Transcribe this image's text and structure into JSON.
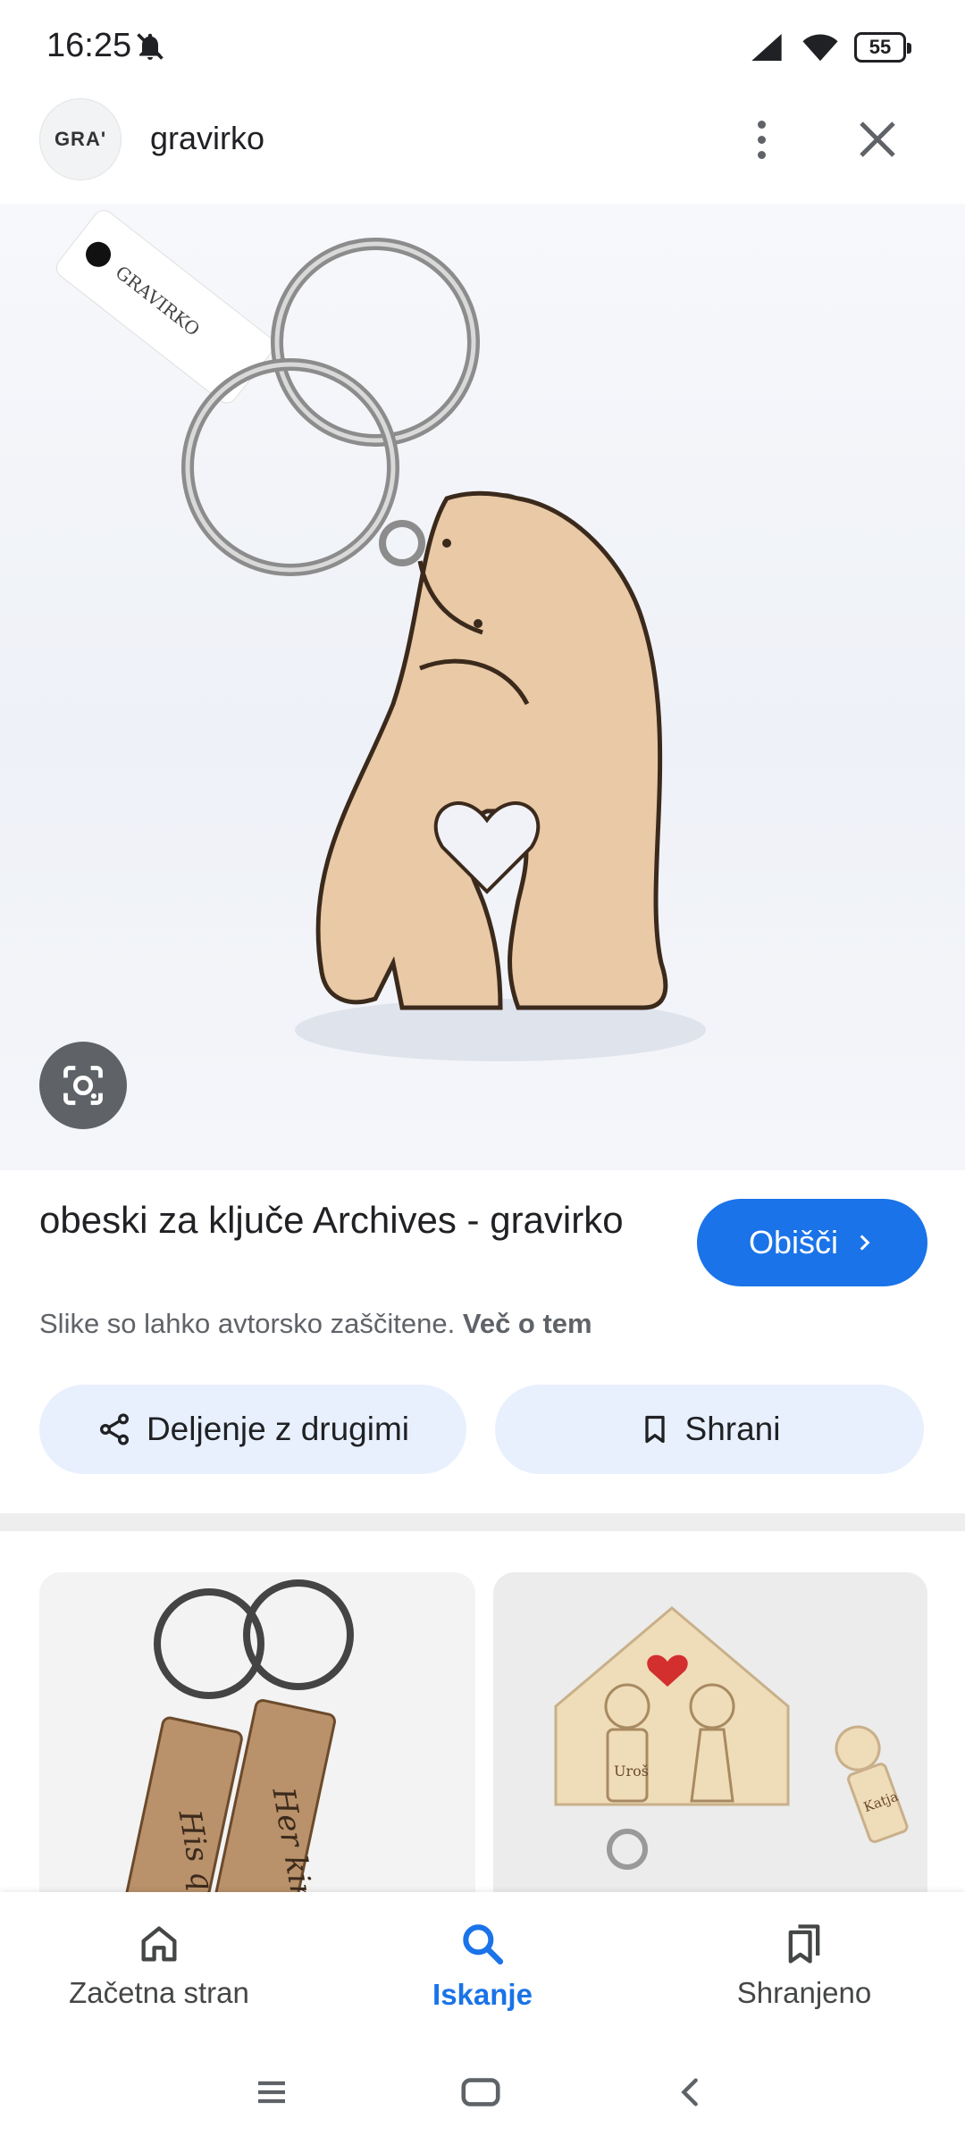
{
  "status_bar": {
    "time": "16:25",
    "battery": "55",
    "icons": [
      "bell-muted-icon",
      "signal-icon",
      "wifi-icon",
      "battery-icon"
    ]
  },
  "header": {
    "logo_text": "GRA'",
    "site_name": "gravirko",
    "icons": [
      "more-vert-icon",
      "close-icon"
    ]
  },
  "result": {
    "title": "obeski za ključe Archives - gravirko",
    "visit_label": "Obišči",
    "copyright_text": "Slike so lahko avtorsko zaščitene.",
    "learn_more": "Več o tem",
    "share_label": "Deljenje z drugimi",
    "save_label": "Shrani"
  },
  "bottom_nav": {
    "items": [
      {
        "label": "Začetna stran",
        "icon": "home-icon"
      },
      {
        "label": "Iskanje",
        "icon": "search-icon"
      },
      {
        "label": "Shranjeno",
        "icon": "bookmarks-icon"
      }
    ]
  },
  "colors": {
    "accent": "#1a73e8",
    "chip_bg": "#e8f0fe",
    "wood": "#e9c9a6",
    "heart": "#d32f2f"
  }
}
